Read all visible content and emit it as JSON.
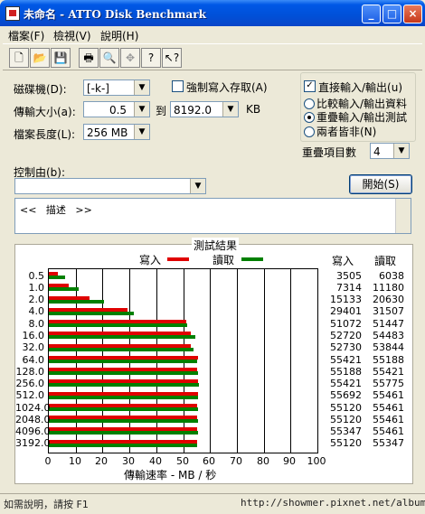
{
  "window": {
    "title": "未命名 - ATTO Disk Benchmark",
    "controls": [
      "_",
      "□",
      "×"
    ]
  },
  "menu": [
    {
      "label": "檔案(F)"
    },
    {
      "label": "檢視(V)"
    },
    {
      "label": "說明(H)"
    }
  ],
  "toolbar": {
    "icons": [
      "new-file-icon",
      "open-folder-icon",
      "save-icon",
      "print-icon",
      "print-preview-icon",
      "move-icon",
      "help-icon",
      "context-help-icon"
    ]
  },
  "form": {
    "drive_label": "磁碟機(D):",
    "drive_value": "[-k-]",
    "transfer_label": "傳輸大小(a):",
    "transfer_from": "0.5",
    "transfer_to_label": "到",
    "transfer_to": "8192.0",
    "transfer_unit": "KB",
    "length_label": "檔案長度(L):",
    "length_value": "256 MB",
    "force_write_label": "強制寫入存取(A)",
    "force_write_checked": false,
    "direct_io_label": "直接輸入/輸出(u)",
    "direct_io_checked": true,
    "radio_compare": "比較輸入/輸出資料",
    "radio_overlap": "重疊輸入/輸出測試",
    "radio_neither": "兩者皆非(N)",
    "radio_selected": "overlap",
    "queue_label": "重疊項目數",
    "queue_value": "4",
    "control_label": "控制由(b):",
    "control_value": "",
    "start_button": "開始(S)",
    "description": "<<   描述   >>"
  },
  "results": {
    "title": "測試結果",
    "write_legend": "寫入",
    "read_legend": "讀取",
    "write_col": "寫入",
    "read_col": "讀取",
    "write_color": "#e00000",
    "read_color": "#008000"
  },
  "chart_data": {
    "type": "bar",
    "title": "測試結果",
    "xlabel": "傳輸速率 - MB / 秒",
    "xlim": [
      0,
      100
    ],
    "x_ticks": [
      "0",
      "10",
      "20",
      "30",
      "40",
      "50",
      "60",
      "70",
      "80",
      "90",
      "100"
    ],
    "categories": [
      "0.5",
      "1.0",
      "2.0",
      "4.0",
      "8.0",
      "16.0",
      "32.0",
      "64.0",
      "128.0",
      "256.0",
      "512.0",
      "1024.0",
      "2048.0",
      "4096.0",
      "3192.0"
    ],
    "series": [
      {
        "name": "寫入",
        "values": [
          3.5,
          7.3,
          15.1,
          29.4,
          51.1,
          52.7,
          52.7,
          55.4,
          55.2,
          55.4,
          55.7,
          55.1,
          55.1,
          55.3,
          55.1
        ]
      },
      {
        "name": "讀取",
        "values": [
          6.0,
          11.2,
          20.6,
          31.5,
          51.4,
          54.5,
          53.8,
          55.2,
          55.4,
          55.8,
          55.5,
          55.5,
          55.5,
          55.5,
          55.3
        ]
      }
    ],
    "write_text": [
      "3505",
      "7314",
      "15133",
      "29401",
      "51072",
      "52720",
      "52730",
      "55421",
      "55188",
      "55421",
      "55692",
      "55120",
      "55120",
      "55347",
      "55120"
    ],
    "read_text": [
      "6038",
      "11180",
      "20630",
      "31507",
      "51447",
      "54483",
      "53844",
      "55188",
      "55421",
      "55775",
      "55461",
      "55461",
      "55461",
      "55461",
      "55347"
    ]
  },
  "status": {
    "left": "如需說明，請按 F1",
    "right": "http://showmer.pixnet.net/album"
  }
}
